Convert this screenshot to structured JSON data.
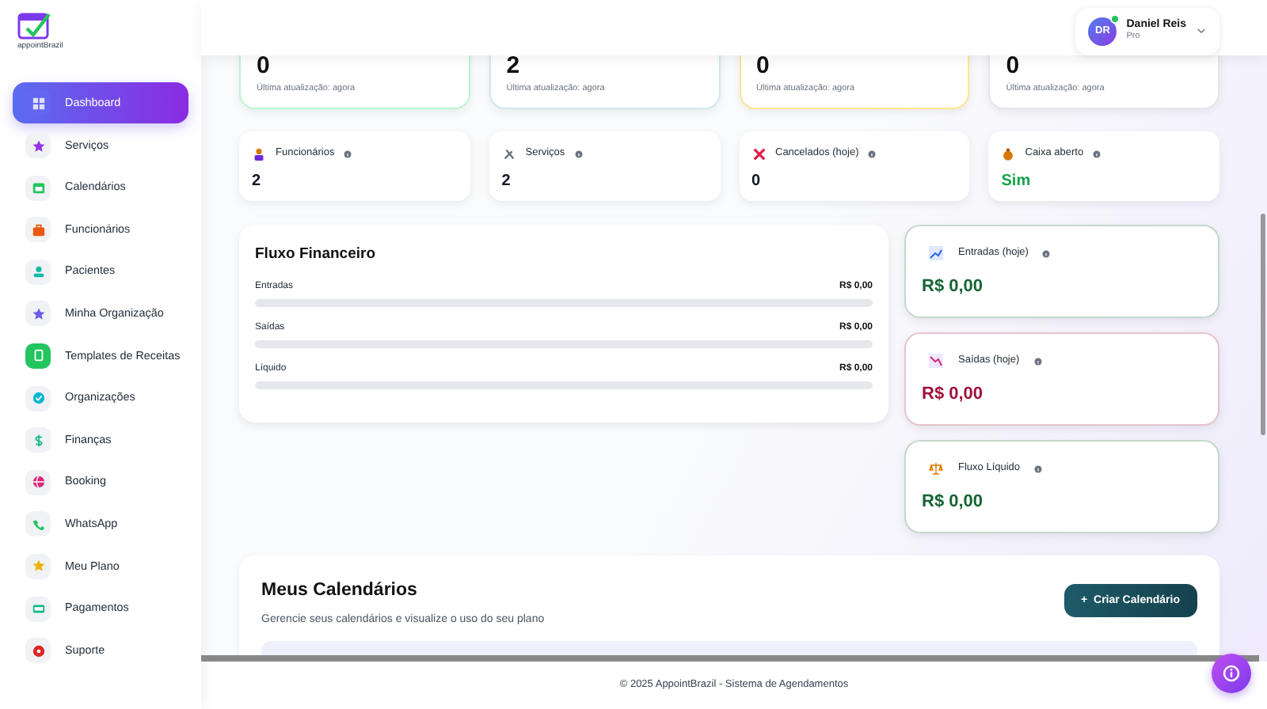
{
  "brand": {
    "name": "appointBrazil"
  },
  "sidebar": {
    "items": [
      {
        "label": "Dashboard",
        "selected": true,
        "color": "#6366f1"
      },
      {
        "label": "Serviços",
        "selected": false,
        "color": "#9333ea"
      },
      {
        "label": "Calendários",
        "selected": false,
        "color": "#22c55e"
      },
      {
        "label": "Funcionários",
        "selected": false,
        "color": "#ea580c"
      },
      {
        "label": "Pacientes",
        "selected": false,
        "color": "#14b8a6"
      },
      {
        "label": "Minha Organização",
        "selected": false,
        "color": "#6d5ce8"
      },
      {
        "label": "Templates de Receitas",
        "selected": false,
        "color": "#22c55e"
      },
      {
        "label": "Organizações",
        "selected": false,
        "color": "#06b6d4"
      },
      {
        "label": "Finanças",
        "selected": false,
        "color": "#10b981"
      },
      {
        "label": "Booking",
        "selected": false,
        "color": "#db2777"
      },
      {
        "label": "WhatsApp",
        "selected": false,
        "color": "#22c55e"
      },
      {
        "label": "Meu Plano",
        "selected": false,
        "color": "#eab308"
      },
      {
        "label": "Pagamentos",
        "selected": false,
        "color": "#10b981"
      },
      {
        "label": "Suporte",
        "selected": false,
        "color": "#dc2626"
      }
    ]
  },
  "user": {
    "initials": "DR",
    "name": "Daniel Reis",
    "plan": "Pro",
    "online": true
  },
  "stat_cards": [
    {
      "value": "0",
      "caption": "Última atualização: agora",
      "color": "#bbf7d0"
    },
    {
      "value": "2",
      "caption": "Última atualização: agora",
      "color": "#cfe8ee"
    },
    {
      "value": "0",
      "caption": "Última atualização: agora",
      "color": "#fde68a"
    },
    {
      "value": "0",
      "caption": "Última atualização: agora",
      "color": "#e5e7eb"
    }
  ],
  "metric_cards": [
    {
      "label": "Funcionários",
      "value": "2",
      "color": "#111827"
    },
    {
      "label": "Serviços",
      "value": "2",
      "color": "#111827"
    },
    {
      "label": "Cancelados (hoje)",
      "value": "0",
      "color": "#111827"
    },
    {
      "label": "Caixa aberto",
      "value": "Sim",
      "color": "#16a34a"
    }
  ],
  "cash_flow": {
    "title": "Fluxo Financeiro",
    "rows": [
      {
        "label": "Entradas",
        "amount": "R$ 0,00",
        "level": 0
      },
      {
        "label": "Saídas",
        "amount": "R$ 0,00",
        "level": 0
      },
      {
        "label": "Líquido",
        "amount": "R$ 0,00",
        "level": 0
      }
    ]
  },
  "today_cards": [
    {
      "label": "Entradas (hoje)",
      "value": "R$ 0,00",
      "color": "#166534"
    },
    {
      "label": "Saídas (hoje)",
      "value": "R$ 0,00",
      "color": "#9f1239"
    },
    {
      "label": "Fluxo Líquido",
      "value": "R$ 0,00",
      "color": "#166534"
    }
  ],
  "calendars": {
    "title": "Meus Calendários",
    "subtitle": "Gerencie seus calendários e visualize o uso do seu plano",
    "button": "Criar Calendário",
    "button_icon": "+"
  },
  "footer": "© 2025 AppointBrazil - Sistema de Agendamentos"
}
